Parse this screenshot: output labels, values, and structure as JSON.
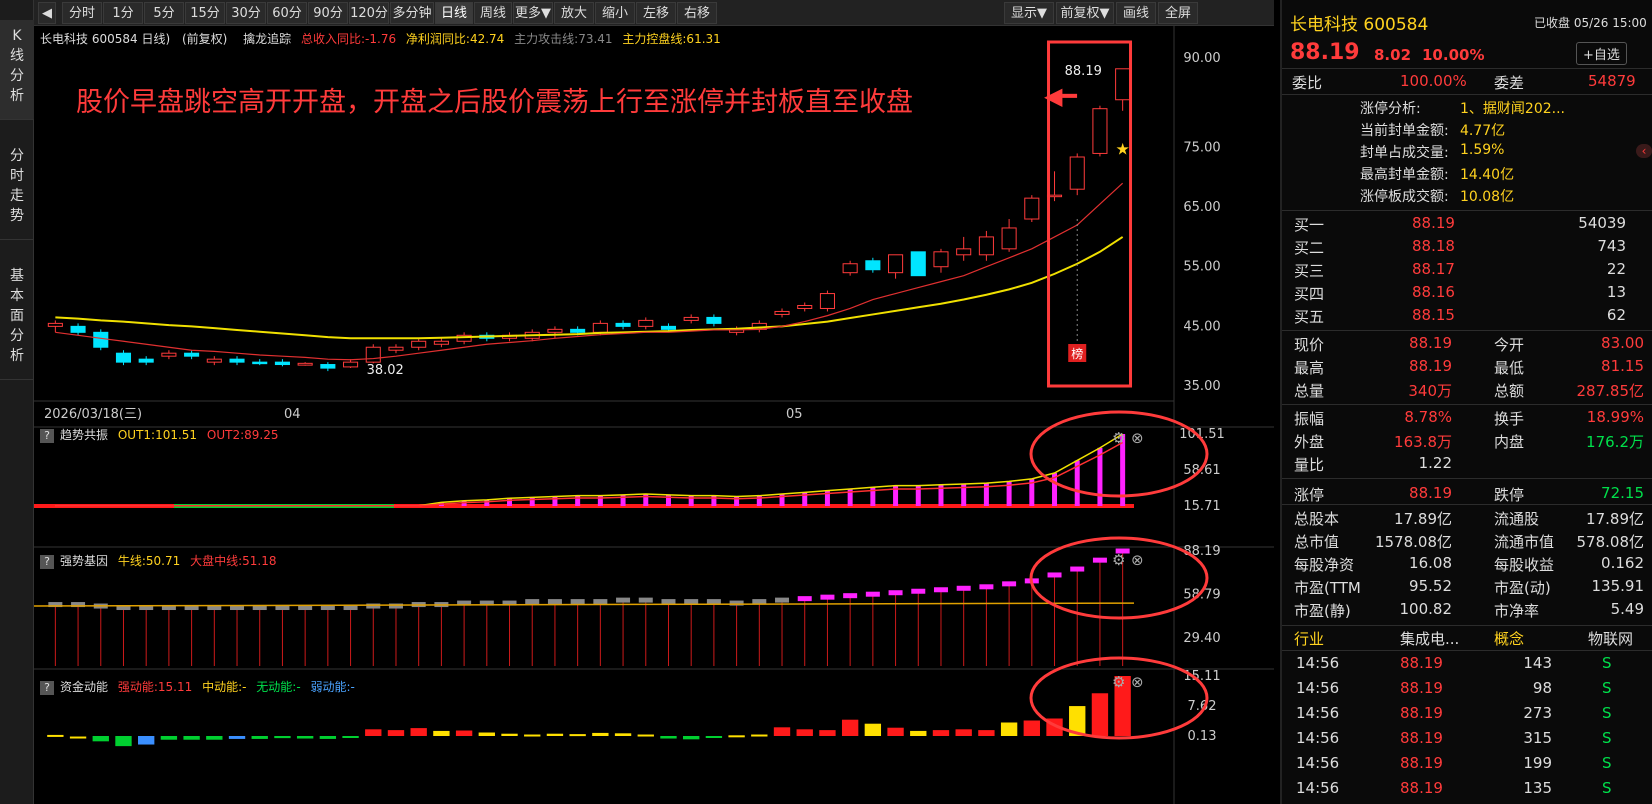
{
  "sidebar": {
    "tabs": [
      {
        "label": "K\n线\n分\n析"
      },
      {
        "label": "分\n时\n走\n势"
      },
      {
        "label": "基\n本\n面\n分\n析"
      }
    ]
  },
  "toolbar": {
    "back_icon": "◀",
    "left_items": [
      "分时",
      "1分",
      "5分",
      "15分",
      "30分",
      "60分",
      "90分",
      "120分",
      "多分钟",
      "日线",
      "周线",
      "更多▼",
      "放大",
      "缩小",
      "左移",
      "右移"
    ],
    "right_items": [
      "显示▼",
      "前复权▼",
      "画线",
      "全屏"
    ],
    "active": "日线"
  },
  "chart_header": {
    "title": "长电科技 600584 日线)",
    "adj": "(前复权)",
    "indicator_name": "擒龙追踪",
    "rev": "总收入同比:-1.76",
    "profit": "净利润同比:42.74",
    "attack": "主力攻击线:73.41",
    "control": "主力控盘线:61.31"
  },
  "annotation": {
    "text": "股价早盘跳空高开开盘，开盘之后股价震荡上行至涨停并封板直至收盘",
    "arrow": "◀━",
    "high_label": "88.19",
    "low_label": "38.02",
    "bang": "榜"
  },
  "panels": {
    "p1": {
      "q": "?",
      "name": "趋势共振",
      "out1": "OUT1:101.51",
      "out2": "OUT2:89.25"
    },
    "p2": {
      "q": "?",
      "name": "强势基因",
      "bull": "牛线:50.71",
      "mkt": "大盘中线:51.18"
    },
    "p3": {
      "q": "?",
      "name": "资金动能",
      "strong": "强动能:15.11",
      "mid": "中动能:-",
      "none": "无动能:-",
      "weak": "弱动能:-"
    }
  },
  "axes": {
    "price_ticks": [
      "90.00",
      "75.00",
      "65.00",
      "55.00",
      "45.00",
      "35.00"
    ],
    "date_labels": [
      "2026/03/18(三)",
      "04",
      "05"
    ],
    "p1_ticks": [
      "101.51",
      "58.61",
      "15.71"
    ],
    "p2_ticks": [
      "88.19",
      "58.79",
      "29.40"
    ],
    "p3_ticks": [
      "15.11",
      "7.62",
      "0.13"
    ]
  },
  "colors": {
    "up": "#ff3b3b",
    "down": "#00e5ff",
    "ma1": "#e03030",
    "ma2": "#f0e000",
    "annot": "#ff3b3b"
  },
  "chart_data": {
    "type": "candlestick",
    "price_axis": [
      35,
      90
    ],
    "candles": [
      [
        45,
        46,
        44,
        45.5
      ],
      [
        45,
        45.5,
        43.5,
        44
      ],
      [
        44,
        44.5,
        41,
        41.5
      ],
      [
        40.5,
        41,
        38.5,
        39
      ],
      [
        39.5,
        40,
        38.5,
        39
      ],
      [
        40,
        41,
        39.5,
        40.5
      ],
      [
        40.5,
        41,
        39.5,
        40
      ],
      [
        39,
        40,
        38.5,
        39.5
      ],
      [
        39.5,
        40,
        38.5,
        39
      ],
      [
        39,
        39.5,
        38.5,
        38.8
      ],
      [
        39,
        39.5,
        38.3,
        38.6
      ],
      [
        38.5,
        39,
        38.4,
        38.8
      ],
      [
        38.6,
        39,
        37.5,
        38
      ],
      [
        38.2,
        39.5,
        38.02,
        39
      ],
      [
        39,
        42,
        38.8,
        41.5
      ],
      [
        41,
        42,
        40.5,
        41.5
      ],
      [
        41.5,
        43,
        41,
        42.5
      ],
      [
        42,
        43,
        41.5,
        42.5
      ],
      [
        42.5,
        44,
        42,
        43.5
      ],
      [
        43.5,
        44,
        42.5,
        43
      ],
      [
        43,
        44,
        42.5,
        43.5
      ],
      [
        43,
        44.5,
        42.5,
        44
      ],
      [
        44,
        45,
        43,
        44.5
      ],
      [
        44.5,
        45,
        43.5,
        44
      ],
      [
        44,
        46,
        43.5,
        45.5
      ],
      [
        45.5,
        46,
        44.5,
        45
      ],
      [
        45,
        46.5,
        44.5,
        46
      ],
      [
        45,
        45.5,
        44,
        44.5
      ],
      [
        46,
        47,
        45.5,
        46.5
      ],
      [
        46.5,
        47,
        45,
        45.5
      ],
      [
        44,
        45,
        43.5,
        44.5
      ],
      [
        44.5,
        46,
        44,
        45.5
      ],
      [
        47,
        48,
        46.5,
        47.5
      ],
      [
        48,
        49,
        47.5,
        48.5
      ],
      [
        48,
        51,
        47.5,
        50.5
      ],
      [
        54,
        56,
        53.5,
        55.5
      ],
      [
        56,
        56.5,
        54,
        54.5
      ],
      [
        54,
        57,
        53,
        57
      ],
      [
        57.5,
        57.5,
        53.5,
        53.5
      ],
      [
        55,
        58,
        54,
        57.5
      ],
      [
        57,
        60,
        56,
        58
      ],
      [
        57,
        61,
        56,
        60
      ],
      [
        58,
        63,
        57.5,
        61.5
      ],
      [
        63,
        67,
        62.5,
        66.5
      ],
      [
        67,
        71,
        66,
        67
      ],
      [
        68,
        74,
        67,
        73.4
      ],
      [
        74,
        82,
        73.5,
        81.5
      ],
      [
        83,
        88.19,
        81.15,
        88.19
      ]
    ],
    "ma_short": [
      44,
      43.5,
      43,
      42.5,
      42,
      41.5,
      41,
      40.8,
      40.5,
      40.2,
      40,
      39.8,
      39.5,
      39.4,
      39.6,
      40,
      40.5,
      41,
      41.5,
      42,
      42.3,
      42.6,
      43,
      43.3,
      43.6,
      43.8,
      44,
      44,
      44.2,
      44.4,
      44.4,
      44.5,
      45,
      45.8,
      46.8,
      48,
      49.5,
      50.5,
      51.5,
      52.5,
      53.5,
      55,
      56.5,
      58,
      60,
      62,
      65.5,
      69
    ],
    "ma_long": [
      46.5,
      46.3,
      46,
      45.8,
      45.5,
      45.2,
      45,
      44.7,
      44.4,
      44.1,
      43.8,
      43.5,
      43.2,
      43,
      43,
      43,
      43,
      43.1,
      43.2,
      43.3,
      43.4,
      43.5,
      43.6,
      43.7,
      43.9,
      44,
      44.1,
      44.2,
      44.4,
      44.5,
      44.6,
      44.8,
      45,
      45.4,
      45.8,
      46.4,
      47,
      47.6,
      48.2,
      48.8,
      49.5,
      50.3,
      51.2,
      52.3,
      53.8,
      55.5,
      57.5,
      60
    ],
    "p1_bars": [
      15.71,
      15.71,
      15.71,
      15.71,
      15.71,
      15.71,
      15.71,
      15.71,
      15.71,
      15.71,
      15.71,
      15.71,
      15.71,
      15.71,
      15.71,
      15.71,
      15.71,
      20,
      22,
      23,
      25,
      26,
      27,
      28,
      28,
      29,
      30,
      29,
      28,
      28,
      27,
      28,
      30,
      32,
      34,
      36,
      38,
      40,
      40,
      41,
      42,
      43,
      45,
      48,
      55,
      70,
      85,
      101.51
    ],
    "p2_bars": [
      52,
      52,
      51,
      50,
      50,
      50,
      50,
      50,
      50,
      50,
      50,
      50,
      50,
      50,
      51,
      51,
      52,
      52,
      53,
      53,
      53,
      54,
      54,
      54,
      54,
      55,
      55,
      54,
      54,
      54,
      53,
      54,
      55,
      56,
      57,
      58,
      59,
      60,
      61,
      62,
      63,
      64,
      66,
      68,
      72,
      76,
      82,
      88.19
    ],
    "p3_bars": [
      0.4,
      0,
      -1.2,
      -2.4,
      -2.0,
      -0.8,
      -0.8,
      -0.8,
      -0.6,
      -0.6,
      -0.4,
      -0.5,
      -0.6,
      -0.2,
      1.8,
      1.6,
      2.1,
      1.4,
      1.5,
      1.0,
      0.7,
      0.5,
      0.7,
      0.6,
      0.9,
      0.8,
      0.5,
      -0.5,
      -0.7,
      -0.3,
      0.3,
      0.5,
      2.3,
      1.8,
      1.6,
      4.2,
      3.2,
      2.2,
      1.4,
      1.6,
      1.8,
      1.6,
      3.5,
      4.0,
      4.5,
      7.6,
      10.8,
      15.11
    ]
  },
  "quote": {
    "name": "长电科技 600584",
    "status": "已收盘 05/26 15:00",
    "price": "88.19",
    "change": "8.02",
    "pct": "10.00%",
    "fav": "+自选",
    "weibi_l": "委比",
    "weibi": "100.00%",
    "weicha_l": "委差",
    "weicha": "54879",
    "zt_items": [
      {
        "k": "涨停分析:",
        "v": "1、据财闻202..."
      },
      {
        "k": "当前封单金额:",
        "v": "4.77亿"
      },
      {
        "k": "封单占成交量:",
        "v": "1.59%"
      },
      {
        "k": "最高封单金额:",
        "v": "14.40亿"
      },
      {
        "k": "涨停板成交额:",
        "v": "10.08亿"
      }
    ],
    "bids": [
      {
        "l": "买一",
        "p": "88.19",
        "v": "54039"
      },
      {
        "l": "买二",
        "p": "88.18",
        "v": "743"
      },
      {
        "l": "买三",
        "p": "88.17",
        "v": "22"
      },
      {
        "l": "买四",
        "p": "88.16",
        "v": "13"
      },
      {
        "l": "买五",
        "p": "88.15",
        "v": "62"
      }
    ],
    "stats1": [
      {
        "a": "现价",
        "av": "88.19",
        "b": "今开",
        "bv": "83.00"
      },
      {
        "a": "最高",
        "av": "88.19",
        "b": "最低",
        "bv": "81.15"
      },
      {
        "a": "总量",
        "av": "340万",
        "b": "总额",
        "bv": "287.85亿"
      }
    ],
    "stats2": [
      {
        "a": "振幅",
        "av": "8.78%",
        "b": "换手",
        "bv": "18.99%"
      },
      {
        "a": "外盘",
        "av": "163.8万",
        "b": "内盘",
        "bv": "176.2万"
      },
      {
        "a": "量比",
        "av": "1.22",
        "b": "",
        "bv": ""
      }
    ],
    "limit": {
      "a": "涨停",
      "av": "88.19",
      "b": "跌停",
      "bv": "72.15"
    },
    "stats3": [
      {
        "a": "总股本",
        "av": "17.89亿",
        "b": "流通股",
        "bv": "17.89亿"
      },
      {
        "a": "总市值",
        "av": "1578.08亿",
        "b": "流通市值",
        "bv": "578.08亿"
      },
      {
        "a": "每股净资",
        "av": "16.08",
        "b": "每股收益",
        "bv": "0.162"
      },
      {
        "a": "市盈(TTM",
        "av": "95.52",
        "b": "市盈(动)",
        "bv": "135.91"
      },
      {
        "a": "市盈(静)",
        "av": "100.82",
        "b": "市净率",
        "bv": "5.49"
      }
    ],
    "industry": {
      "a": "行业",
      "av": "集成电...",
      "b": "概念",
      "bv": "物联网"
    },
    "ticks": [
      {
        "t": "14:56",
        "p": "88.19",
        "v": "143",
        "s": "S"
      },
      {
        "t": "14:56",
        "p": "88.19",
        "v": "98",
        "s": "S"
      },
      {
        "t": "14:56",
        "p": "88.19",
        "v": "273",
        "s": "S"
      },
      {
        "t": "14:56",
        "p": "88.19",
        "v": "315",
        "s": "S"
      },
      {
        "t": "14:56",
        "p": "88.19",
        "v": "199",
        "s": "S"
      },
      {
        "t": "14:56",
        "p": "88.19",
        "v": "135",
        "s": "S"
      }
    ]
  }
}
